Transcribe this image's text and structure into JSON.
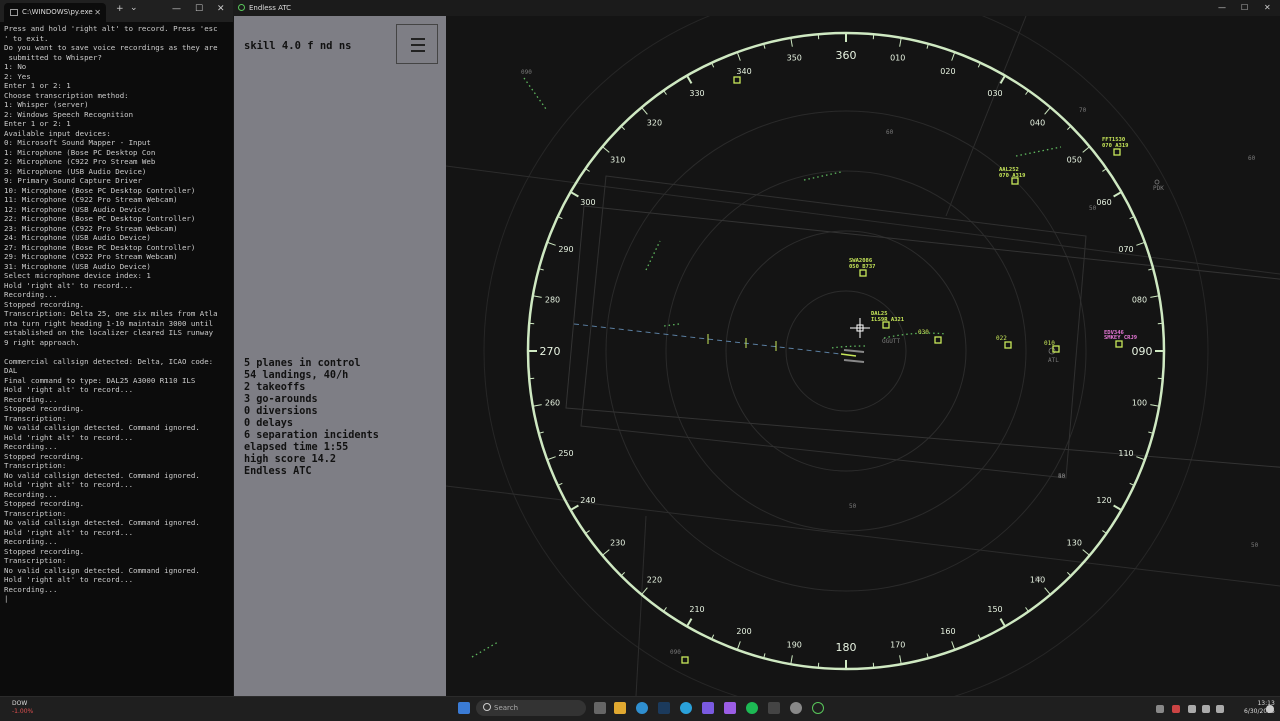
{
  "terminal": {
    "tab_title": "C:\\WINDOWS\\py.exe",
    "new_tab": "+",
    "dropdown": "⌄",
    "lines": [
      "Press and hold 'right alt' to record. Press 'esc",
      "' to exit.",
      "Do you want to save voice recordings as they are",
      " submitted to Whisper?",
      "1: No",
      "2: Yes",
      "Enter 1 or 2: 1",
      "Choose transcription method:",
      "1: Whisper (server)",
      "2: Windows Speech Recognition",
      "Enter 1 or 2: 1",
      "Available input devices:",
      "0: Microsoft Sound Mapper - Input",
      "1: Microphone (Bose PC Desktop Con",
      "2: Microphone (C922 Pro Stream Web",
      "3: Microphone (USB Audio Device)",
      "9: Primary Sound Capture Driver",
      "10: Microphone (Bose PC Desktop Controller)",
      "11: Microphone (C922 Pro Stream Webcam)",
      "12: Microphone (USB Audio Device)",
      "22: Microphone (Bose PC Desktop Controller)",
      "23: Microphone (C922 Pro Stream Webcam)",
      "24: Microphone (USB Audio Device)",
      "27: Microphone (Bose PC Desktop Controller)",
      "29: Microphone (C922 Pro Stream Webcam)",
      "31: Microphone (USB Audio Device)",
      "Select microphone device index: 1",
      "Hold 'right alt' to record...",
      "Recording...",
      "Stopped recording.",
      "Transcription: Delta 25, one six miles from Atla",
      "nta turn right heading 1-10 maintain 3000 until",
      "established on the localizer cleared ILS runway",
      "9 right approach.",
      "",
      "Commercial callsign detected: Delta, ICAO code:",
      "DAL",
      "Final command to type: DAL25 A3000 R110 ILS",
      "Hold 'right alt' to record...",
      "Recording...",
      "Stopped recording.",
      "Transcription:",
      "No valid callsign detected. Command ignored.",
      "Hold 'right alt' to record...",
      "Recording...",
      "Stopped recording.",
      "Transcription:",
      "No valid callsign detected. Command ignored.",
      "Hold 'right alt' to record...",
      "Recording...",
      "Stopped recording.",
      "Transcription:",
      "No valid callsign detected. Command ignored.",
      "Hold 'right alt' to record...",
      "Recording...",
      "Stopped recording.",
      "Transcription:",
      "No valid callsign detected. Command ignored.",
      "Hold 'right alt' to record...",
      "Recording...",
      "|"
    ]
  },
  "game": {
    "window_title": "Endless ATC",
    "skill": "skill 4.0 f nd ns",
    "stats": [
      "5 planes in control",
      "54 landings, 40/h",
      "2 takeoffs",
      "3 go-arounds",
      "0 diversions",
      "0 delays",
      "6 separation incidents",
      "elapsed time 1:55",
      "high score 14.2",
      "Endless ATC"
    ],
    "compass": [
      "360",
      "010",
      "020",
      "030",
      "040",
      "050",
      "060",
      "070",
      "080",
      "090",
      "100",
      "110",
      "120",
      "130",
      "140",
      "150",
      "160",
      "170",
      "180",
      "190",
      "200",
      "210",
      "220",
      "230",
      "240",
      "250",
      "260",
      "270",
      "280",
      "290",
      "300",
      "310",
      "320",
      "330",
      "340",
      "350"
    ],
    "aircraft": [
      {
        "callsign": "DAL25",
        "info": "ILS9R A321",
        "color": "#c8e85a"
      },
      {
        "callsign": "SWA2086",
        "info": "050  B737",
        "color": "#c8e85a"
      },
      {
        "callsign": "AAL252",
        "info": "070  A319",
        "color": "#c8e85a"
      },
      {
        "callsign": "FFT1530",
        "info": "070  A319",
        "color": "#c8e85a"
      },
      {
        "callsign": "EDV346",
        "info": "SMKEY CRJ9",
        "color": "#e878d8"
      }
    ],
    "fixes": [
      {
        "label": "090"
      },
      {
        "label": "112"
      },
      {
        "label": "090"
      },
      {
        "label": "030"
      },
      {
        "label": "022"
      },
      {
        "label": "010"
      },
      {
        "label": "PDK"
      },
      {
        "label": "GGUTT"
      },
      {
        "label": "ATL"
      },
      {
        "label": "70"
      },
      {
        "label": "60"
      },
      {
        "label": "50"
      },
      {
        "label": "60"
      },
      {
        "label": "50"
      },
      {
        "label": "40"
      },
      {
        "label": "50"
      },
      {
        "label": "60"
      },
      {
        "label": "50"
      }
    ],
    "colors": {
      "ring": "#cfe9c2",
      "accent": "#58c65a",
      "panel": "#7e7e85"
    }
  },
  "taskbar": {
    "stock_name": "DOW",
    "stock_change": "-1.00%",
    "search_label": "Search",
    "time": "13:13",
    "date": "6/30/2025"
  }
}
